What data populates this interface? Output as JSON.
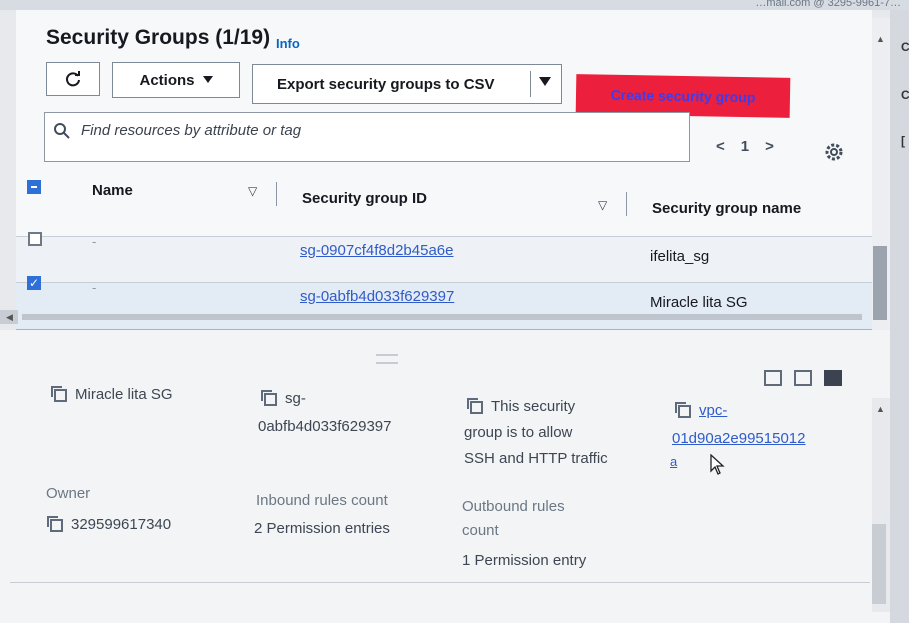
{
  "account_email": "…mail.com @ 3295-9961-7…",
  "header": {
    "title": "Security Groups",
    "count": "(1/19)",
    "info_label": "Info"
  },
  "toolbar": {
    "actions_label": "Actions",
    "export_label": "Export security groups to CSV",
    "create_label": "Create security group"
  },
  "search": {
    "placeholder": "Find resources by attribute or tag"
  },
  "pagination": {
    "prev": "<",
    "page": "1",
    "next": ">"
  },
  "table": {
    "columns": [
      "Name",
      "Security group ID",
      "Security group name"
    ],
    "rows": [
      {
        "name": "-",
        "id": "sg-0907cf4f8d2b45a6e",
        "group_name": "ifelita_sg",
        "selected": false
      },
      {
        "name": "-",
        "id": "sg-0abfb4d033f629397",
        "group_name": "Miracle lita SG",
        "selected": true
      }
    ]
  },
  "details": {
    "name": "Miracle lita SG",
    "id_line1": "sg-",
    "id_line2": "0abfb4d033f629397",
    "description_line1": "This security",
    "description_line2": "group is to allow",
    "description_line3": "SSH and HTTP traffic",
    "vpc_line1": "vpc-",
    "vpc_line2": "01d90a2e99515012",
    "vpc_line3": "a",
    "owner_label": "Owner",
    "owner_value": "329599617340",
    "inbound_label": "Inbound rules count",
    "inbound_value": "2 Permission entries",
    "outbound_label_line1": "Outbound rules",
    "outbound_label_line2": "count",
    "outbound_value": "1 Permission entry"
  },
  "right_edge_letters": [
    "C",
    "C",
    "["
  ],
  "colors": {
    "create_button": "#ec1f3c",
    "link": "#2f5cc9",
    "checkbox": "#2f6fd8"
  }
}
